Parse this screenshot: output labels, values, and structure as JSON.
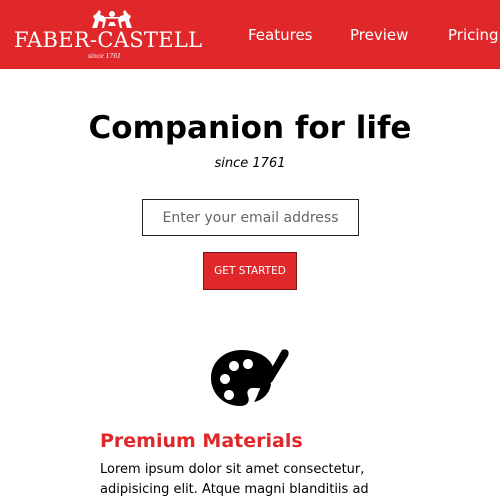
{
  "header": {
    "brand_name": "FABER-CASTELL",
    "brand_since": "since 1761",
    "nav": {
      "features": "Features",
      "preview": "Preview",
      "pricing": "Pricing"
    }
  },
  "hero": {
    "title": "Companion for life",
    "subtitle": "since 1761",
    "email_placeholder": "Enter your email address",
    "cta_label": "GET STARTED"
  },
  "feature": {
    "icon": "palette-icon",
    "title": "Premium Materials",
    "text": "Lorem ipsum dolor sit amet consectetur, adipisicing elit. Atque magni blanditiis ad"
  },
  "colors": {
    "brand_red": "#e0282b",
    "text": "#000000",
    "background": "#ffffff"
  }
}
